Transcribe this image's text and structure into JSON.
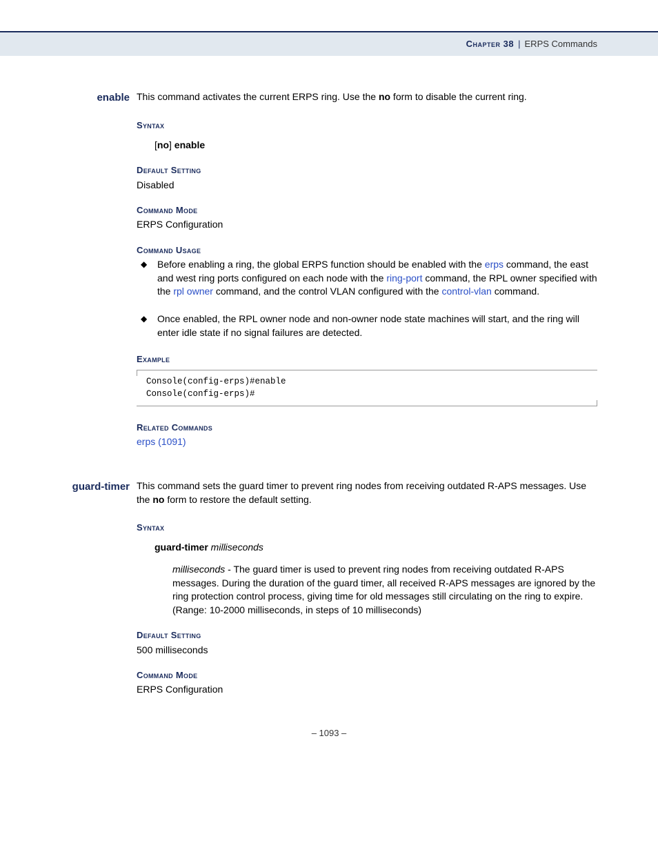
{
  "header": {
    "chapter_label": "Chapter 38",
    "separator": "|",
    "title": "ERPS Commands"
  },
  "page_number": "–  1093  –",
  "sections": [
    {
      "name": "enable",
      "intro_pre": "This command activates the current ERPS ring. Use the ",
      "intro_bold": "no",
      "intro_post": " form to disable the current ring.",
      "syntax_heading": "Syntax",
      "syntax_bracket_open": "[",
      "syntax_no": "no",
      "syntax_bracket_close": "]",
      "syntax_cmd": " enable",
      "default_heading": "Default Setting",
      "default_value": "Disabled",
      "mode_heading": "Command Mode",
      "mode_value": "ERPS Configuration",
      "usage_heading": "Command Usage",
      "usage_items": [
        {
          "t1": "Before enabling a ring, the global ERPS function should be enabled with the ",
          "l1": "erps",
          "t2": " command, the east and west ring ports configured on each node with the ",
          "l2": "ring-port",
          "t3": " command, the RPL owner specified with the ",
          "l3": "rpl owner",
          "t4": " command, and the control VLAN configured with the ",
          "l4": "control-vlan",
          "t5": " command."
        },
        {
          "t1": "Once enabled, the RPL owner node and non-owner node state machines will start, and the ring will enter idle state if no signal failures are detected."
        }
      ],
      "example_heading": "Example",
      "example_code": "Console(config-erps)#enable\nConsole(config-erps)#",
      "related_heading": "Related Commands",
      "related_link": "erps (1091)"
    },
    {
      "name": "guard-timer",
      "intro_pre": "This command sets the guard timer to prevent ring nodes from receiving outdated R-APS messages. Use the ",
      "intro_bold": "no",
      "intro_post": " form to restore the default setting.",
      "syntax_heading": "Syntax",
      "syntax_cmd": "guard-timer",
      "syntax_arg": " milliseconds",
      "param_name": "milliseconds",
      "param_desc": " - The guard timer is used to prevent ring nodes from receiving outdated R-APS messages. During the duration of the guard timer, all received R-APS messages are ignored by the ring protection control process, giving time for old messages still circulating on the ring to expire. (Range: 10-2000 milliseconds, in steps of 10 milliseconds)",
      "default_heading": "Default Setting",
      "default_value": "500 milliseconds",
      "mode_heading": "Command Mode",
      "mode_value": "ERPS Configuration"
    }
  ]
}
